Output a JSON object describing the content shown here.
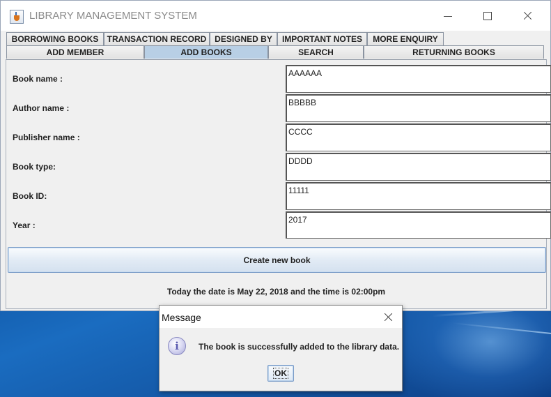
{
  "window": {
    "title": "LIBRARY MANAGEMENT SYSTEM"
  },
  "tabs_row1": [
    {
      "label": "BORROWING BOOKS"
    },
    {
      "label": "TRANSACTION RECORD"
    },
    {
      "label": "DESIGNED BY"
    },
    {
      "label": "IMPORTANT NOTES"
    },
    {
      "label": "MORE ENQUIRY"
    }
  ],
  "tabs_row2": [
    {
      "label": "ADD MEMBER"
    },
    {
      "label": "ADD BOOKS",
      "selected": true
    },
    {
      "label": "SEARCH"
    },
    {
      "label": "RETURNING BOOKS"
    }
  ],
  "form": {
    "book_name": {
      "label": "Book name  :",
      "value": "AAAAAA"
    },
    "author_name": {
      "label": "Author name  :",
      "value": "BBBBB"
    },
    "publisher_name": {
      "label": "Publisher name :",
      "value": "CCCC"
    },
    "book_type": {
      "label": "Book type:",
      "value": "DDDD"
    },
    "book_id": {
      "label": "Book ID:",
      "value": "11111"
    },
    "year": {
      "label": "Year  :",
      "value": "2017"
    }
  },
  "create_button_label": "Create new book",
  "status_text": "Today the date is May 22, 2018 and the time is 02:00pm",
  "dialog": {
    "title": "Message",
    "icon": "info-icon",
    "icon_glyph": "i",
    "message": "The book is successfully added to the library data.",
    "ok_label": "OK"
  },
  "colors": {
    "selected_tab": "#b8cfe5",
    "desktop": "#0b4c98"
  }
}
